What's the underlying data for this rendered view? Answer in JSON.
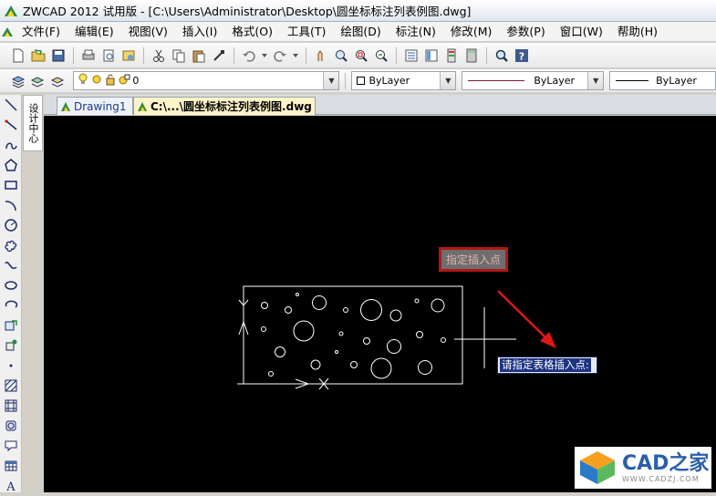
{
  "window": {
    "title": "ZWCAD 2012 试用版 - [C:\\Users\\Administrator\\Desktop\\圆坐标标注列表例图.dwg]"
  },
  "menu": {
    "items": [
      {
        "label": "文件(F)"
      },
      {
        "label": "编辑(E)"
      },
      {
        "label": "视图(V)"
      },
      {
        "label": "插入(I)"
      },
      {
        "label": "格式(O)"
      },
      {
        "label": "工具(T)"
      },
      {
        "label": "绘图(D)"
      },
      {
        "label": "标注(N)"
      },
      {
        "label": "修改(M)"
      },
      {
        "label": "参数(P)"
      },
      {
        "label": "窗口(W)"
      },
      {
        "label": "帮助(H)"
      }
    ]
  },
  "properties": {
    "layer_value": "0",
    "color_value": "ByLayer",
    "linetype_value": "ByLayer",
    "lineweight_value": "ByLayer"
  },
  "side_panel": {
    "vertical_tab_label": "设计中心"
  },
  "tabs": [
    {
      "label": "Drawing1",
      "active": false
    },
    {
      "label": "C:\\...\\圆坐标标注列表例图.dwg",
      "active": true
    }
  ],
  "canvas": {
    "annotation_label": "指定插入点",
    "command_prompt": "请指定表格插入点:"
  },
  "watermark": {
    "brand": "CAD之家",
    "url": "WWW.CADZJ.COM"
  },
  "colors": {
    "canvas_bg": "#000000",
    "arrow": "#e01616",
    "annotation_border": "#b31616",
    "prompt_bg": "#1e3380"
  }
}
